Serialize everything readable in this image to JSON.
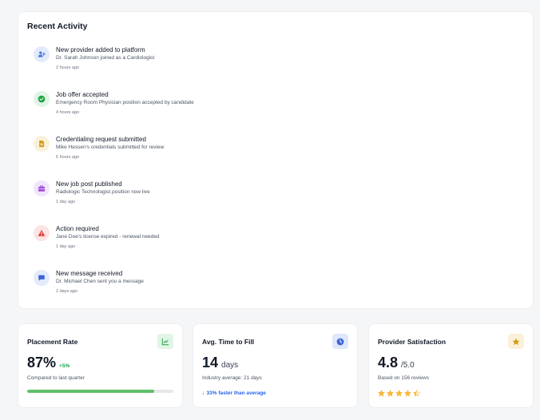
{
  "recent_activity": {
    "title": "Recent Activity",
    "items": [
      {
        "icon": "user-plus-icon",
        "icon_color": "#4b6fd6",
        "icon_bg": "#e3eafb",
        "title": "New provider added to platform",
        "description": "Dr. Sarah Johnson joined as a Cardiologist",
        "time": "2 hours ago"
      },
      {
        "icon": "check-circle-icon",
        "icon_color": "#22a447",
        "icon_bg": "#e1f4e6",
        "title": "Job offer accepted",
        "description": "Emergency Room Physician position accepted by candidate",
        "time": "4 hours ago"
      },
      {
        "icon": "document-icon",
        "icon_color": "#d69a1a",
        "icon_bg": "#fbf1d9",
        "title": "Credentialing request submitted",
        "description": "Mike Hessen's credentials submitted for review",
        "time": "6 hours ago"
      },
      {
        "icon": "briefcase-icon",
        "icon_color": "#9b4fd6",
        "icon_bg": "#f1e5fb",
        "title": "New job post published",
        "description": "Radiologic Technologist position now live",
        "time": "1 day ago"
      },
      {
        "icon": "warning-icon",
        "icon_color": "#dc3b3b",
        "icon_bg": "#fde3e3",
        "title": "Action required",
        "description": "Jane Doe's license expired - renewal needed",
        "time": "1 day ago"
      },
      {
        "icon": "message-icon",
        "icon_color": "#3d63d6",
        "icon_bg": "#e3eafb",
        "title": "New message received",
        "description": "Dr. Michael Chen sent you a message",
        "time": "2 days ago"
      }
    ]
  },
  "stats": {
    "placement": {
      "label": "Placement Rate",
      "value": "87%",
      "delta": "+5%",
      "subtitle": "Compared to last quarter",
      "progress": 0.87,
      "icon": "trend-chart-icon",
      "icon_color": "#22a447",
      "icon_bg": "#e1f4e6"
    },
    "time_to_fill": {
      "label": "Avg. Time to Fill",
      "value": "14",
      "unit": "days",
      "subtitle": "Industry average: 21 days",
      "note": "33% faster than average",
      "icon": "clock-icon",
      "icon_color": "#3d63d6",
      "icon_bg": "#dfe7fa"
    },
    "satisfaction": {
      "label": "Provider Satisfaction",
      "value": "4.8",
      "unit": "/5.0",
      "subtitle": "Based on 156 reviews",
      "rating": 4.5,
      "rating_max": 5,
      "icon": "star-icon",
      "icon_color": "#d69a1a",
      "icon_bg": "#fbf1d9",
      "star_color": "#f4b942"
    }
  }
}
